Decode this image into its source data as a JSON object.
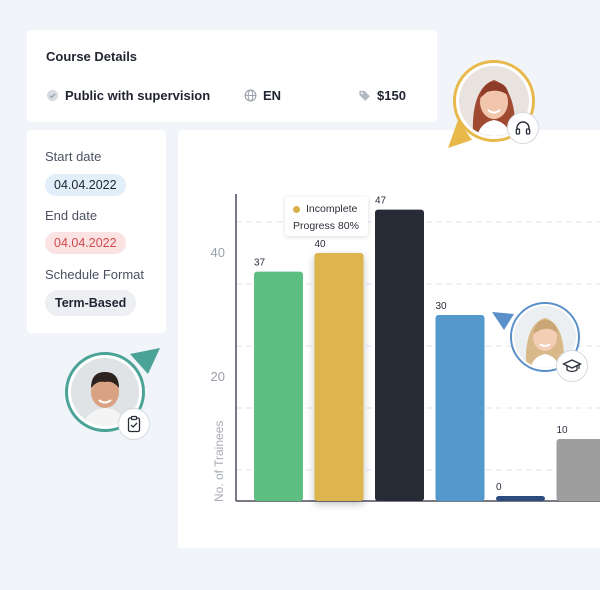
{
  "course": {
    "title": "Course Details",
    "visibility": "Public with supervision",
    "visibility_icon": "check-circle-icon",
    "language": "EN",
    "language_icon": "globe-icon",
    "price": "$150",
    "price_icon": "tag-icon"
  },
  "schedule": {
    "start_label": "Start date",
    "start_value": "04.04.2022",
    "end_label": "End date",
    "end_value": "04.04.2022",
    "format_label": "Schedule Format",
    "format_value": "Term-Based"
  },
  "tooltip": {
    "status": "Incomplete",
    "progress": "Progress 80%"
  },
  "colors": {
    "accent_yellow": "#e8b84a",
    "accent_teal": "#4aa396",
    "accent_blue": "#5b8fc9"
  },
  "chart_data": {
    "type": "bar",
    "ylabel": "No. of Trainees",
    "ylim": [
      0,
      50
    ],
    "yticks": [
      20,
      40
    ],
    "grid": true,
    "values": [
      37,
      40,
      47,
      30,
      0,
      10
    ],
    "colors": [
      "#5cbf81",
      "#deb44e",
      "#272b35",
      "#5399cc",
      "#2c4b7f",
      "#9e9e9e"
    ]
  }
}
